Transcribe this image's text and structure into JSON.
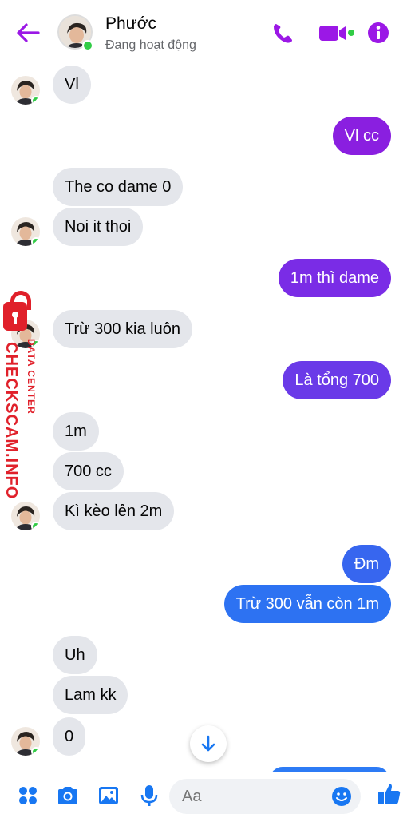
{
  "header": {
    "contact_name": "Phước",
    "status": "Đang hoạt động",
    "colors": {
      "accent": "#9b18e6",
      "online": "#31cc46"
    },
    "icons": [
      "back-arrow-icon",
      "phone-icon",
      "video-camera-icon",
      "info-icon"
    ]
  },
  "messages": [
    {
      "from": "contact",
      "text": "Vl"
    },
    {
      "from": "me",
      "text": "Vl cc",
      "color": "#8a1fe0"
    },
    {
      "from": "contact",
      "text": "The co dame 0"
    },
    {
      "from": "contact",
      "text": "Noi it thoi"
    },
    {
      "from": "me",
      "text": "1m thì dame",
      "color": "#7a2ce6"
    },
    {
      "from": "contact",
      "text": "Trừ 300 kia luôn"
    },
    {
      "from": "me",
      "text": "Là tổng 700",
      "color": "#6a3ae8"
    },
    {
      "from": "contact",
      "text": "1m"
    },
    {
      "from": "contact",
      "text": "700 cc"
    },
    {
      "from": "contact",
      "text": "Kì kèo lên 2m"
    },
    {
      "from": "me",
      "text": "Đm",
      "color": "#3766ef"
    },
    {
      "from": "me",
      "text": "Trừ 300 vẫn còn 1m",
      "color": "#2d72f2"
    },
    {
      "from": "contact",
      "text": "Uh"
    },
    {
      "from": "contact",
      "text": "Lam kk"
    },
    {
      "from": "contact",
      "text": "0"
    }
  ],
  "watermark": {
    "main": "CHECKSCAM.INFO",
    "sub": "DATA CENTER",
    "color": "#e0202a"
  },
  "composer": {
    "placeholder": "Aa",
    "icons": [
      "grid-menu-icon",
      "camera-icon",
      "image-icon",
      "microphone-icon",
      "emoji-icon",
      "like-thumb-icon"
    ],
    "accent": "#1877f2"
  }
}
